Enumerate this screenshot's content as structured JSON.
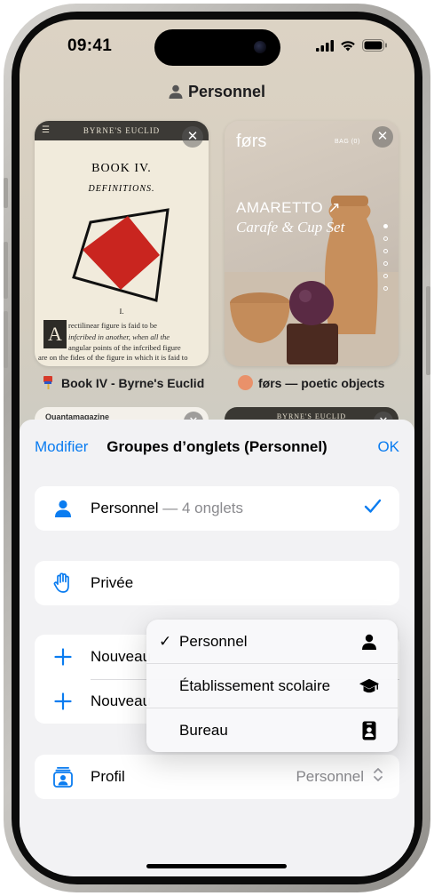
{
  "status_bar": {
    "time": "09:41"
  },
  "group_title": "Personnel",
  "tabs": [
    {
      "label": "Book IV - Byrne's Euclid",
      "preview": {
        "header": "BYRNE'S EUCLID",
        "book": "BOOK IV.",
        "definitions": "DEFINITIONS.",
        "section": "I.",
        "dropcap": "A",
        "text_lines": [
          "rectilinear figure is faid to be",
          "infcribed in another, when all the",
          "angular points of the infcribed figure"
        ],
        "text_last": "are on the fides of the figure in which it is faid to"
      }
    },
    {
      "label": "førs — poetic objects",
      "preview": {
        "logo": "førs",
        "bag": "BAG (0)",
        "headline": "AMARETTO ↗",
        "subline": "Carafe & Cup Set"
      }
    }
  ],
  "peek_tabs": [
    {
      "text": "Quantamagazine"
    },
    {
      "text": "BYRNE'S EUCLID"
    }
  ],
  "sheet": {
    "edit_label": "Modifier",
    "title": "Groupes d’onglets (Personnel)",
    "done_label": "OK",
    "personnel_row": {
      "name": "Personnel",
      "detail": " — 4 onglets"
    },
    "private_row": {
      "label": "Privée"
    },
    "new_rows": [
      {
        "label": "Nouveau"
      },
      {
        "label": "Nouveau"
      }
    ],
    "profile_row": {
      "label": "Profil",
      "value": "Personnel"
    }
  },
  "profile_menu": {
    "items": [
      {
        "label": "Personnel",
        "checked": "✓",
        "icon": "person-icon"
      },
      {
        "label": "Établissement scolaire",
        "checked": "",
        "icon": "graduation-cap-icon"
      },
      {
        "label": "Bureau",
        "checked": "",
        "icon": "id-badge-icon"
      }
    ]
  },
  "colors": {
    "accent": "#0a7cf0",
    "sheet_bg": "#f2f2f4",
    "cell_bg": "#ffffff",
    "secondary_text": "#8a8a8e"
  }
}
